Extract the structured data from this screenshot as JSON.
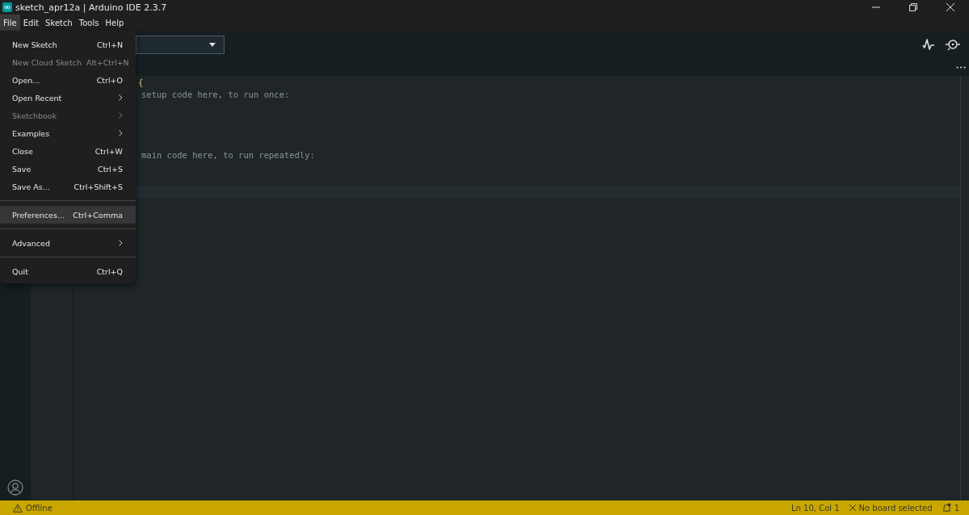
{
  "window": {
    "title": "sketch_apr12a | Arduino IDE 2.3.7"
  },
  "menubar": [
    {
      "label": "File",
      "selected": true
    },
    {
      "label": "Edit",
      "selected": false
    },
    {
      "label": "Sketch",
      "selected": false
    },
    {
      "label": "Tools",
      "selected": false
    },
    {
      "label": "Help",
      "selected": false
    }
  ],
  "file_menu": [
    {
      "kind": "item",
      "label": "New Sketch",
      "shortcut": "Ctrl+N",
      "disabled": false,
      "selected": false,
      "submenu": false
    },
    {
      "kind": "item",
      "label": "New Cloud Sketch",
      "shortcut": "Alt+Ctrl+N",
      "disabled": true,
      "selected": false,
      "submenu": false
    },
    {
      "kind": "item",
      "label": "Open...",
      "shortcut": "Ctrl+O",
      "disabled": false,
      "selected": false,
      "submenu": false
    },
    {
      "kind": "item",
      "label": "Open Recent",
      "disabled": false,
      "selected": false,
      "submenu": true
    },
    {
      "kind": "item",
      "label": "Sketchbook",
      "disabled": true,
      "selected": false,
      "submenu": true
    },
    {
      "kind": "item",
      "label": "Examples",
      "disabled": false,
      "selected": false,
      "submenu": true
    },
    {
      "kind": "item",
      "label": "Close",
      "shortcut": "Ctrl+W",
      "disabled": false,
      "selected": false,
      "submenu": false
    },
    {
      "kind": "item",
      "label": "Save",
      "shortcut": "Ctrl+S",
      "disabled": false,
      "selected": false,
      "submenu": false
    },
    {
      "kind": "item",
      "label": "Save As...",
      "shortcut": "Ctrl+Shift+S",
      "disabled": false,
      "selected": false,
      "submenu": false
    },
    {
      "kind": "separator"
    },
    {
      "kind": "item",
      "label": "Preferences...",
      "shortcut": "Ctrl+Comma",
      "disabled": false,
      "selected": true,
      "submenu": false
    },
    {
      "kind": "separator"
    },
    {
      "kind": "item",
      "label": "Advanced",
      "disabled": false,
      "selected": false,
      "submenu": true
    },
    {
      "kind": "separator"
    },
    {
      "kind": "item",
      "label": "Quit",
      "shortcut": "Ctrl+Q",
      "disabled": false,
      "selected": false,
      "submenu": false
    }
  ],
  "editor": {
    "lines": [
      {
        "kind": "brace",
        "text": "{"
      },
      {
        "kind": "comment",
        "text": "setup code here, to run once:"
      },
      {
        "kind": "blank"
      },
      {
        "kind": "blank"
      },
      {
        "kind": "blank"
      },
      {
        "kind": "blank"
      },
      {
        "kind": "comment",
        "text": "main code here, to run repeatedly:"
      },
      {
        "kind": "blank"
      },
      {
        "kind": "blank"
      },
      {
        "kind": "cursor_line"
      }
    ]
  },
  "status_bar": {
    "connection": "Offline",
    "position": "Ln 10, Col 1",
    "board": "No board selected",
    "notifications": "1"
  }
}
